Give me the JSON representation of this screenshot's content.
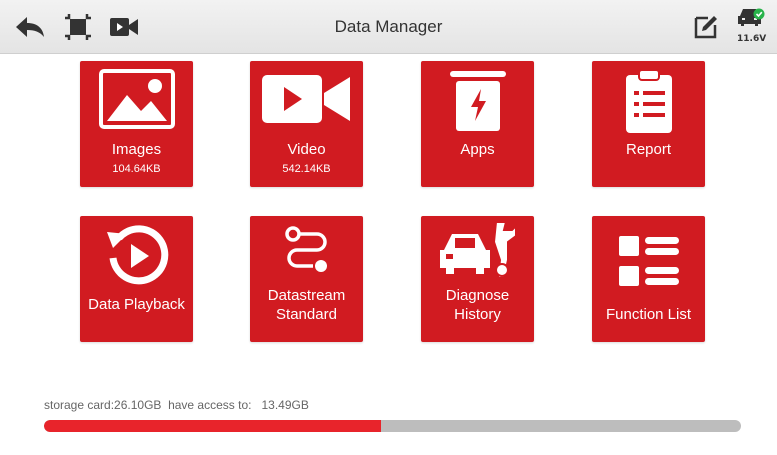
{
  "header": {
    "title": "Data Manager",
    "voltage": "11.6V",
    "icons": [
      "back-arrow-icon",
      "screenshot-icon",
      "video-record-icon",
      "edit-note-icon",
      "car-status-icon"
    ]
  },
  "tiles": [
    {
      "label": "Images",
      "sub": "104.64KB",
      "icon": "image-icon"
    },
    {
      "label": "Video",
      "sub": "542.14KB",
      "icon": "video-icon"
    },
    {
      "label": "Apps",
      "sub": "",
      "icon": "apps-icon"
    },
    {
      "label": "Report",
      "sub": "",
      "icon": "report-icon"
    },
    {
      "label": "Data Playback",
      "sub": "",
      "icon": "playback-icon"
    },
    {
      "label": "Datastream Standard",
      "label_lines": [
        "Datastream",
        "Standard"
      ],
      "icon": "datastream-icon"
    },
    {
      "label": "Diagnose History",
      "label_lines": [
        "Diagnose",
        "History"
      ],
      "icon": "diagnose-history-icon"
    },
    {
      "label": "Function List",
      "sub": "",
      "icon": "function-list-icon"
    }
  ],
  "storage": {
    "card_label": "storage card:26.10GB",
    "access_label": "have access to:",
    "access_value": "13.49GB",
    "used_fraction": 0.484
  },
  "colors": {
    "tile": "#d11b21",
    "bar_fill": "#e8242b",
    "bar_track": "#bdbdbd",
    "status_ok": "#27b34a"
  }
}
